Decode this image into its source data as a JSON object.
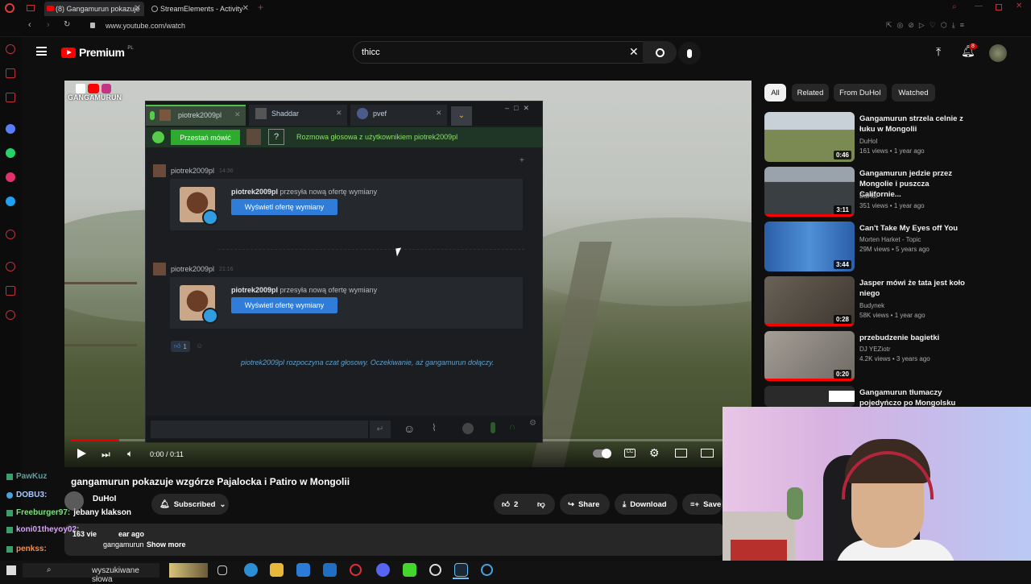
{
  "browser": {
    "tabs": [
      {
        "label": "(8) Gangamurun pokazuje"
      },
      {
        "label": "StreamElements - Activity"
      }
    ],
    "url": "www.youtube.com/watch"
  },
  "youtube": {
    "logo": "Premium",
    "logo_region": "PL",
    "search_value": "thicc",
    "notif_count": "8"
  },
  "player": {
    "channel_watermark": "GANGAMURUN",
    "time": "0:00 / 0:11",
    "progress": 0.0
  },
  "steam": {
    "tabs": [
      {
        "name": "piotrek2009pl"
      },
      {
        "name": "Shaddar"
      },
      {
        "name": "pvef"
      }
    ],
    "stop_talking": "Przestań mówić",
    "voice_status": "Rozmowa głosowa z użytkownikiem piotrek2009pl",
    "messages": [
      {
        "user": "piotrek2009pl",
        "time": "14:36",
        "sender": "piotrek2009pl",
        "text": " przesyła nową ofertę wymiany",
        "button": "Wyświetl ofertę wymiany"
      },
      {
        "user": "piotrek2009pl",
        "time": "21:16",
        "sender": "piotrek2009pl",
        "text": " przesyła nową ofertę wymiany",
        "button": "Wyświetl ofertę wymiany"
      }
    ],
    "reaction_count": "1",
    "voice_notice": "piotrek2009pl rozpoczyna czat głosowy. Oczekiwanie, aż gangamurun dołączy."
  },
  "video_info": {
    "title": "gangamurun pokazuje wzgórze Pajalocka i Patiro w Mongolii",
    "channel": "DuHoI",
    "subscribed": "Subscribed",
    "likes": "2",
    "share": "Share",
    "download": "Download",
    "save": "Save",
    "views_frag": "163 vie",
    "ago_frag": "ear ago",
    "desc_frag": "gangamurun",
    "show_more": "Show more"
  },
  "sidebar": {
    "chips": [
      "All",
      "Related",
      "From DuHoI",
      "Watched"
    ],
    "videos": [
      {
        "title": "Gangamurun strzela celnie z łuku w Mongolii",
        "channel": "DuHoI",
        "meta": "161 views • 1 year ago",
        "duration": "0:46",
        "color": "#7b8a52"
      },
      {
        "title": "Gangamurun jedzie przez Mongolie i puszcza Californie...",
        "channel": "DuHoI",
        "meta": "351 views • 1 year ago",
        "duration": "3:11",
        "color": "#3a3f44"
      },
      {
        "title": "Can't Take My Eyes off You",
        "channel": "Morten Harket - Topic",
        "meta": "29M views • 5 years ago",
        "duration": "3:44",
        "color": "#3b6fb0"
      },
      {
        "title": "Jasper mówi że tata jest koło niego",
        "channel": "Budynek",
        "meta": "58K views • 1 year ago",
        "duration": "0:28",
        "color": "#5a5148"
      },
      {
        "title": "przebudzenie bagietki",
        "channel": "DJ YEZiotr",
        "meta": "4.2K views • 3 years ago",
        "duration": "0:20",
        "color": "#8e8a84"
      },
      {
        "title": "Gangamurun tłumaczy pojedyńczo po Mongolsku",
        "channel": "",
        "meta": "",
        "duration": "",
        "color": "#2a2a2a"
      }
    ]
  },
  "chat": [
    {
      "name": "PawKuz",
      "color": "#5f9ea0"
    },
    {
      "name": "DOBU3:",
      "color": "#a9c9ff"
    },
    {
      "name": "Freeburger97:",
      "color": "#7ee07e",
      "msg": "jebany klakson"
    },
    {
      "name": "koni01theyoy02:",
      "color": "#d9a3ff"
    },
    {
      "name": "penkss:",
      "color": "#ff8c42"
    }
  ],
  "taskbar": {
    "search": "wyszukiwane słowa"
  }
}
